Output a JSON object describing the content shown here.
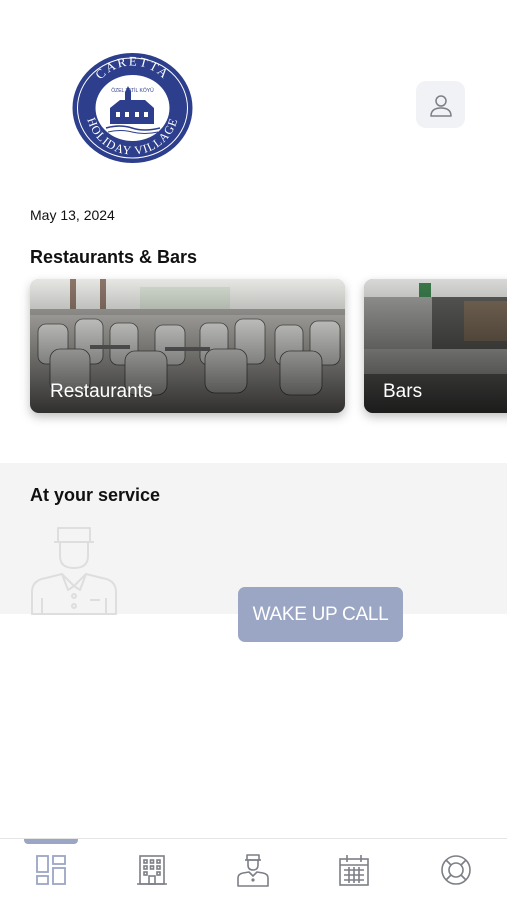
{
  "logo": {
    "top_text": "CARETTA",
    "bottom_text": "HOLIDAY VILLAGE",
    "inner_text": "ÖZEL TATİL KÖYÜ",
    "color": "#2c3e8c"
  },
  "header": {
    "profile_icon": "user-icon"
  },
  "date": "May 13, 2024",
  "restaurants_bars": {
    "title": "Restaurants & Bars",
    "cards": [
      {
        "label": "Restaurants"
      },
      {
        "label": "Bars"
      }
    ]
  },
  "service": {
    "title": "At your service",
    "icon": "butler-icon",
    "wake_up_button": "WAKE UP CALL"
  },
  "bottom_nav": {
    "items": [
      {
        "icon": "dashboard-icon",
        "active": true
      },
      {
        "icon": "hotel-icon",
        "active": false
      },
      {
        "icon": "concierge-icon",
        "active": false
      },
      {
        "icon": "calendar-icon",
        "active": false
      },
      {
        "icon": "lifebuoy-icon",
        "active": false
      }
    ]
  },
  "colors": {
    "accent": "#9ba6c4",
    "brand_blue": "#2c3e8c",
    "service_band": "#f4f4f4",
    "nav_icon": "#7c7f86"
  }
}
